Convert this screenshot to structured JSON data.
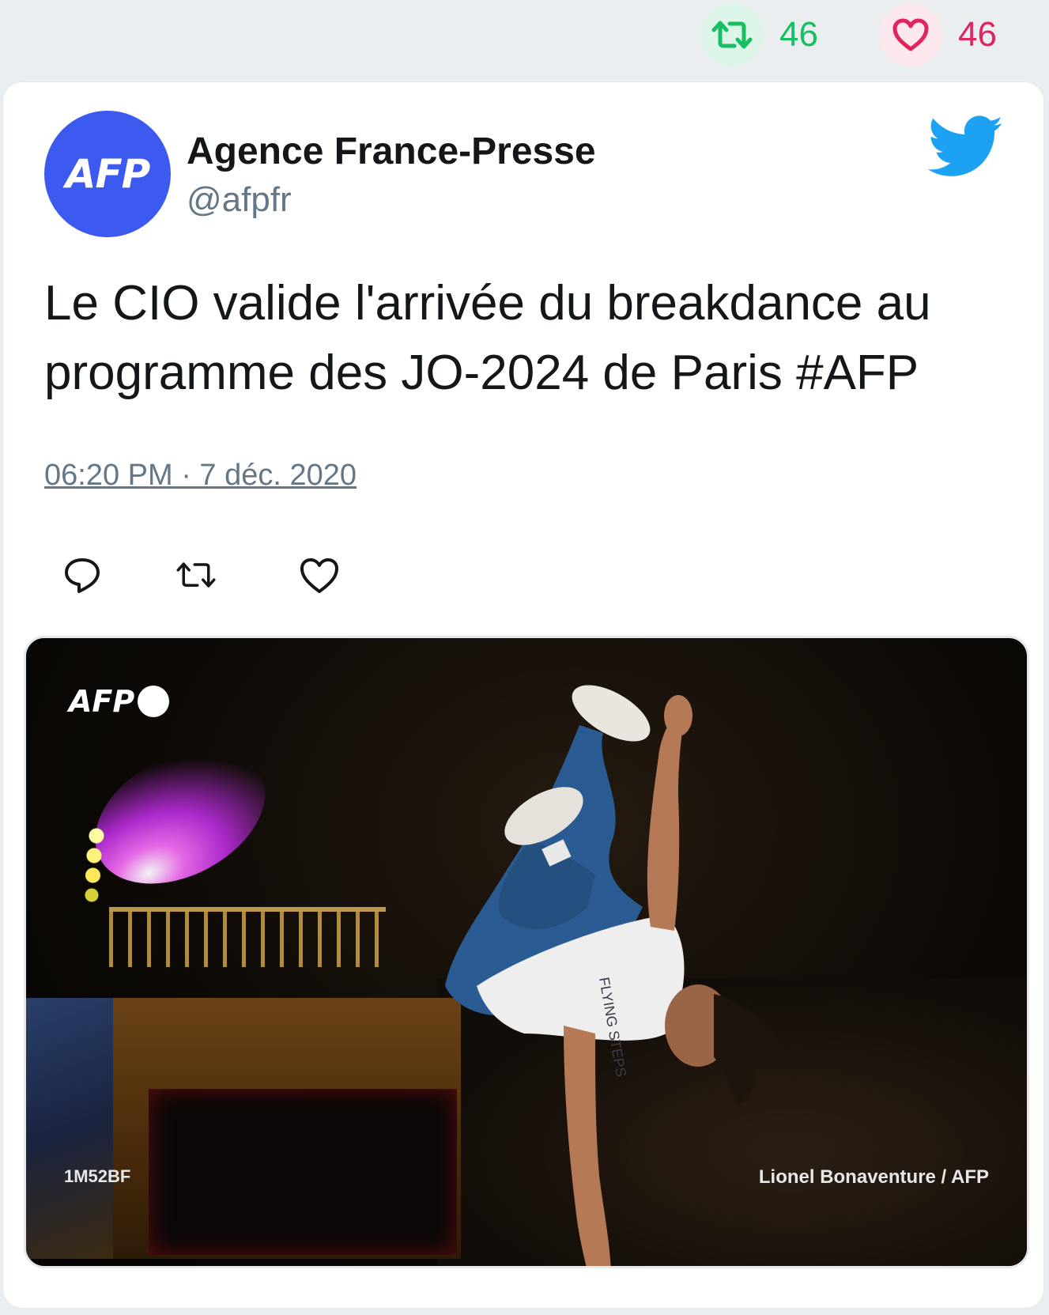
{
  "stats": {
    "retweets": "46",
    "likes": "46"
  },
  "tweet": {
    "avatar_text": "AFP",
    "author_name": "Agence France-Presse",
    "handle": "@afpfr",
    "text": "Le CIO valide l'arrivée du breakdance au programme des JO-2024 de Paris #AFP",
    "timestamp": "06:20 PM · 7 déc. 2020"
  },
  "photo": {
    "watermark": "AFP",
    "photo_code": "1M52BF",
    "credit": "Lionel Bonaventure / AFP"
  },
  "colors": {
    "retweet_green": "#17bf63",
    "like_red": "#e0245e",
    "twitter_blue": "#1da1f2",
    "avatar_blue": "#3c5af0"
  }
}
